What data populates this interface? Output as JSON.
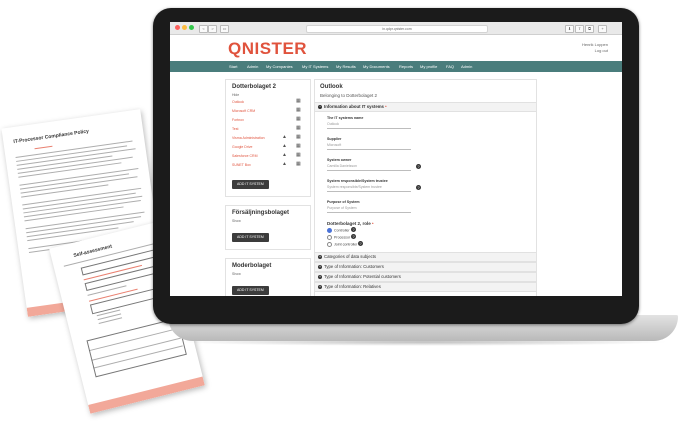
{
  "browser": {
    "url": "in.qdpr.qnister.com",
    "window_buttons": [
      "close",
      "minimize",
      "zoom"
    ],
    "nav": [
      "<",
      ">"
    ]
  },
  "site": {
    "logo": "QNISTER",
    "user_lines": [
      "Henrik Loppen",
      "Log out"
    ],
    "brand_color": "#e0533d",
    "nav_color": "#4a7d7c",
    "nav_items": [
      "Start",
      "Admin",
      "My Companies",
      "My IT Systems",
      "My Results",
      "My Documents",
      "Reports",
      "My profile",
      "FAQ",
      "Admin"
    ]
  },
  "companies": [
    {
      "name": "Dotterbolaget 2",
      "action": "Hide",
      "systems": [
        "Outlook",
        "Microsoft CRM",
        "Fortnox",
        "Test",
        "Visma Administration",
        "Google Drive",
        "Salesforce CRM",
        "SUNET Box"
      ],
      "button": "ADD IT SYSTEM"
    },
    {
      "name": "Försäljningsbolaget",
      "action": "Show",
      "button": "ADD IT SYSTEM"
    },
    {
      "name": "Moderbolaget",
      "action": "Show",
      "button": "ADD IT SYSTEM"
    }
  ],
  "detail": {
    "title": "Outlook",
    "subtitle": "Belonging to Dotterbolaget 2",
    "section_open": "Information about IT systems",
    "required_mark": "•",
    "fields": [
      {
        "label": "The IT systems name",
        "value": "Outlook"
      },
      {
        "label": "Supplier",
        "value": "Microsoft"
      },
      {
        "label": "System owner",
        "value": "Camilla Danielsson"
      },
      {
        "label": "System responsible/System trustee",
        "placeholder": "System responsible/System trustee"
      },
      {
        "label": "Purpose of System",
        "placeholder": "Purpose of System"
      }
    ],
    "role_group": {
      "label": "Dotterbolaget 2, role",
      "options": [
        {
          "label": "Controller",
          "checked": true
        },
        {
          "label": "Processor",
          "checked": false
        },
        {
          "label": "Joint controller",
          "checked": false
        }
      ]
    },
    "collapsed_sections": [
      "Categories of data subjects",
      "Type of Information: Customers",
      "Type of Information: Potential customers",
      "Type of Information: Relatives"
    ]
  },
  "papers": {
    "doc1_title": "IT-Processor Compliance Policy",
    "doc2_title": "Self-assessment"
  }
}
